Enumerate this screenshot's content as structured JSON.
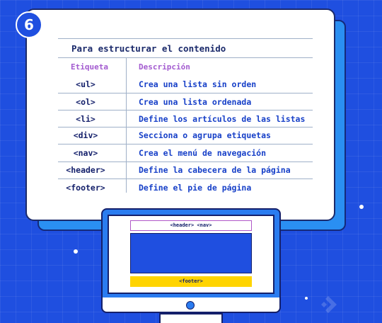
{
  "badge": "6",
  "table": {
    "title": "Para estructurar el contenido",
    "headers": {
      "tag": "Etiqueta",
      "description": "Descripción"
    },
    "rows": [
      {
        "tag": "<ul>",
        "description": "Crea una lista sin orden"
      },
      {
        "tag": "<ol>",
        "description": "Crea una lista ordenada"
      },
      {
        "tag": "<li>",
        "description": "Define los artículos de las listas"
      },
      {
        "tag": "<div>",
        "description": "Secciona o agrupa etiquetas"
      },
      {
        "tag": "<nav>",
        "description": "Crea el menú de navegación"
      },
      {
        "tag": "<header>",
        "description": "Define la cabecera de la página"
      },
      {
        "tag": "<footer>",
        "description": "Define el pie de página"
      }
    ]
  },
  "monitor": {
    "header_label": "<header> <nav>",
    "footer_label": "<footer>"
  },
  "colors": {
    "background": "#1f4fe0",
    "accent": "#2a7cf0",
    "header_text": "#a35bd0",
    "footer_block": "#ffd400"
  },
  "icons": [
    "window-dot-icon",
    "logo-icon"
  ]
}
